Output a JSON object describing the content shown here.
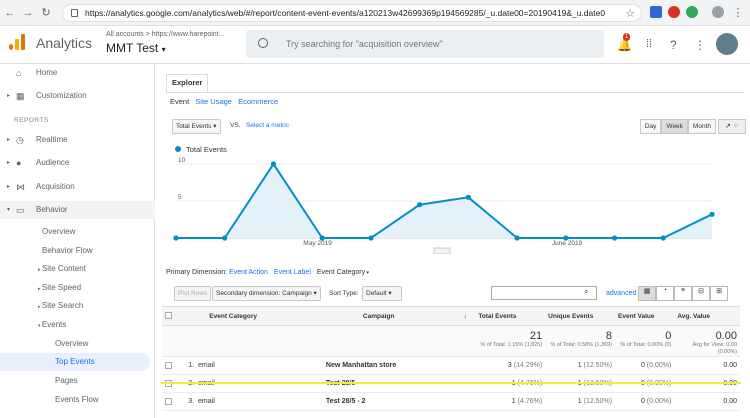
{
  "browser": {
    "url": "https://analytics.google.com/analytics/web/#/report/content-event-events/a120213w42699369p194569285/_u.date00=20190419&_u.date01=201..."
  },
  "header": {
    "brand": "Analytics",
    "accounts": "All accounts > https://www.harepoint...",
    "property": "MMT Test",
    "search_placeholder": "Try searching for \"acquisition overview\"",
    "notification_count": "1"
  },
  "sidebar": {
    "home": "Home",
    "customization": "Customization",
    "reports_section": "REPORTS",
    "realtime": "Realtime",
    "audience": "Audience",
    "acquisition": "Acquisition",
    "behavior": "Behavior",
    "overview": "Overview",
    "behavior_flow": "Behavior Flow",
    "site_content": "Site Content",
    "site_speed": "Site Speed",
    "site_search": "Site Search",
    "events": "Events",
    "events_overview": "Overview",
    "top_events": "Top Events",
    "pages": "Pages",
    "events_flow": "Events Flow"
  },
  "report": {
    "tab": "Explorer",
    "subtabs": [
      "Event",
      "Site Usage",
      "Ecommerce"
    ],
    "metric_select": "Total Events",
    "vs": "VS.",
    "select_metric": "Select a metric",
    "period_buttons": [
      "Day",
      "Week",
      "Month"
    ],
    "primary_dimension_label": "Primary Dimension:",
    "dimensions": [
      "Event Action",
      "Event Label",
      "Event Category"
    ],
    "plot_rows": "Plot Rows",
    "secondary_dimension": "Secondary dimension: Campaign",
    "sort_type_label": "Sort Type:",
    "sort_type": "Default",
    "advanced": "advanced"
  },
  "chart_data": {
    "type": "line",
    "series": [
      {
        "name": "Total Events",
        "values": [
          0,
          0,
          10,
          0,
          0,
          4.5,
          5.5,
          0,
          0,
          0,
          0,
          3.2
        ]
      }
    ],
    "x_tick_labels": [
      "May 2019",
      "June 2019"
    ],
    "y_ticks": [
      "10",
      "5"
    ],
    "ylim": [
      0,
      10
    ],
    "color": "#058dc7"
  },
  "table": {
    "headers": [
      "Event Category",
      "Campaign",
      "Total Events",
      "Unique Events",
      "Event Value",
      "Avg. Value"
    ],
    "totals": {
      "total_events": "21",
      "total_events_sub": "% of Total: 1.15% (1,825)",
      "unique_events": "8",
      "unique_events_sub": "% of Total: 0.58% (1,369)",
      "event_value": "0",
      "event_value_sub": "% of Total: 0.00% (0)",
      "avg_value": "0.00",
      "avg_value_sub": "Avg for View: 0.00 (0.00%)"
    },
    "rows": [
      {
        "n": "1.",
        "category": "email",
        "campaign": "New Manhattan store",
        "total": "3",
        "total_pct": "(14.29%)",
        "unique": "1",
        "unique_pct": "(12.50%)",
        "value": "0",
        "value_pct": "(0.00%)",
        "avg": "0.00"
      },
      {
        "n": "2.",
        "category": "email",
        "campaign": "Test 28/5",
        "total": "1",
        "total_pct": "(4.76%)",
        "unique": "1",
        "unique_pct": "(12.50%)",
        "value": "0",
        "value_pct": "(0.00%)",
        "avg": "0.00"
      },
      {
        "n": "3.",
        "category": "email",
        "campaign": "Test 28/5 - 2",
        "total": "1",
        "total_pct": "(4.76%)",
        "unique": "1",
        "unique_pct": "(12.50%)",
        "value": "0",
        "value_pct": "(0.00%)",
        "avg": "0.00"
      }
    ]
  }
}
